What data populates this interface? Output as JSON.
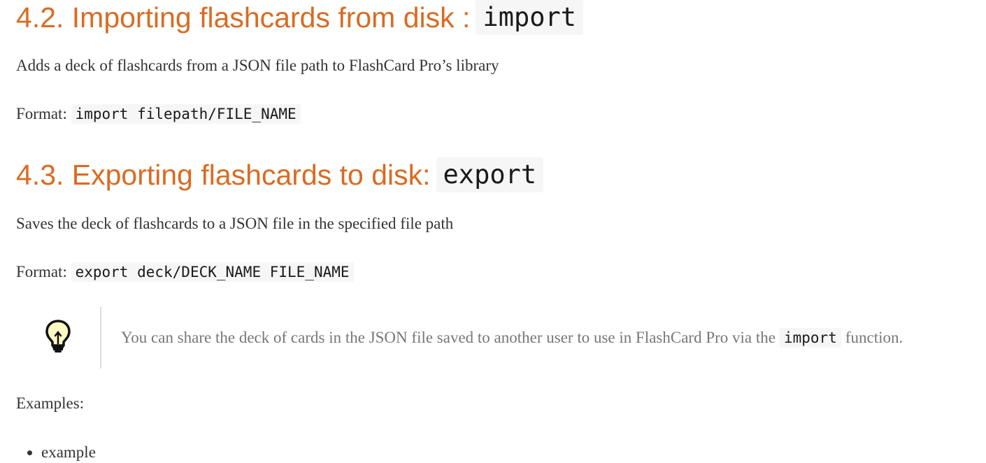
{
  "sections": [
    {
      "title_text": "4.2. Importing flashcards from disk :",
      "title_code": "import",
      "description": "Adds a deck of flashcards from a JSON file path to FlashCard Pro’s library",
      "format_label": "Format:",
      "format_code": "import filepath/FILE_NAME"
    },
    {
      "title_text": "4.3. Exporting flashcards to disk:",
      "title_code": "export",
      "description": "Saves the deck of flashcards to a JSON file in the specified file path",
      "format_label": "Format:",
      "format_code": "export deck/DECK_NAME FILE_NAME"
    }
  ],
  "tip": {
    "icon": "lightbulb-icon",
    "text_before": "You can share the deck of cards in the JSON file saved to another user to use in FlashCard Pro via the",
    "code": "import",
    "text_after": "function."
  },
  "examples": {
    "label": "Examples:",
    "items": [
      "example"
    ]
  },
  "colors": {
    "heading": "#d96b22",
    "code_background": "#f6f6f6",
    "tip_text": "#777777",
    "body_text": "#333333"
  }
}
